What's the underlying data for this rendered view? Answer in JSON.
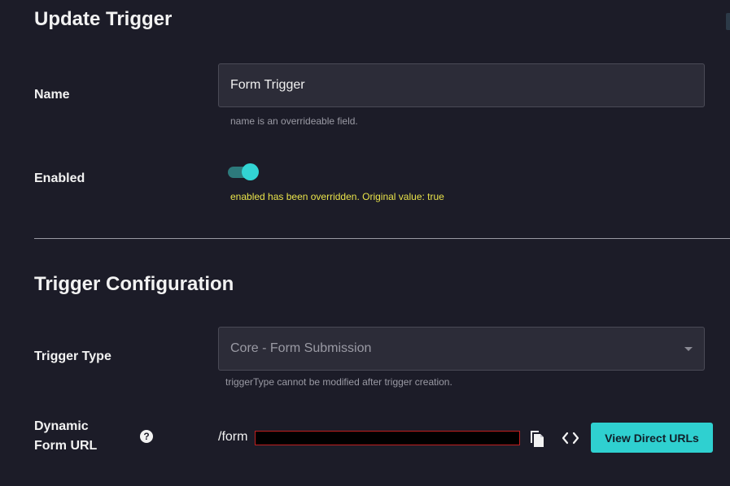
{
  "update_section": {
    "title": "Update Trigger",
    "name_label": "Name",
    "name_value": "Form Trigger",
    "name_helper": "name is an overrideable field.",
    "enabled_label": "Enabled",
    "enabled_on": true,
    "enabled_helper": "enabled has been overridden. Original value: true"
  },
  "config_section": {
    "title": "Trigger Configuration",
    "trigger_type_label": "Trigger Type",
    "trigger_type_value": "Core - Form Submission",
    "trigger_type_helper": "triggerType cannot be modified after trigger creation.",
    "url_label_line1": "Dynamic",
    "url_label_line2": "Form URL",
    "help_glyph": "?",
    "url_prefix": "/form",
    "view_urls_button": "View Direct URLs"
  },
  "icons": {
    "help": "question-circle-icon",
    "copy": "copy-icon",
    "code": "code-brackets-icon"
  },
  "colors": {
    "background": "#1c1c28",
    "accent": "#2fd0d0",
    "toggle_track": "#2d7a7c",
    "warning_text": "#e9e34a",
    "input_bg": "#2c2c38"
  }
}
